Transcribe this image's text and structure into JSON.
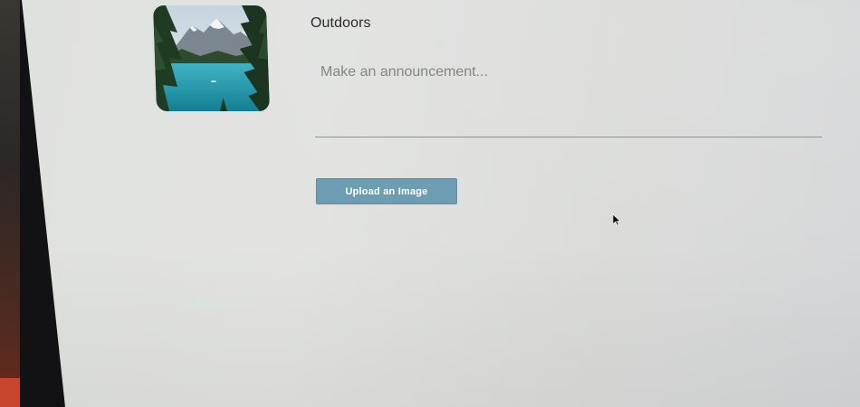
{
  "group": {
    "title": "Outdoors",
    "photo_icon": "lake-mountain-photo"
  },
  "announcement": {
    "placeholder": "Make an announcement...",
    "value": ""
  },
  "upload": {
    "label": "Upload an Image"
  },
  "colors": {
    "button_bg": "#6d9db3",
    "button_text": "#ffffff",
    "title_text": "#2b2b2b",
    "placeholder_text": "#858584",
    "screen_bg": "#dfe1df"
  }
}
